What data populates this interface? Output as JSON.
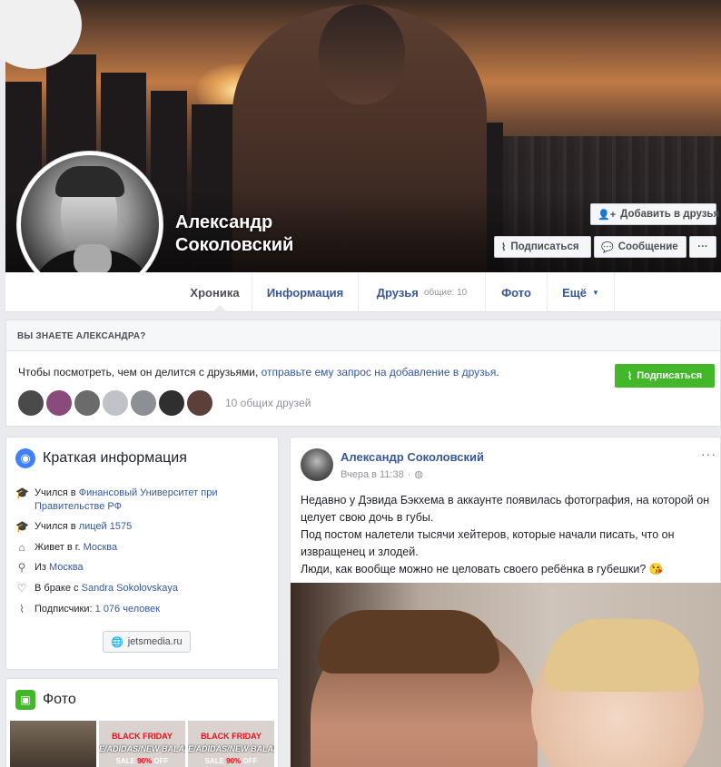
{
  "profile": {
    "name_line1": "Александр",
    "name_line2": "Соколовский"
  },
  "actions": {
    "add_friend": "Добавить в друзья",
    "follow": "Подписаться",
    "message": "Сообщение",
    "more": "···"
  },
  "tabs": [
    {
      "label": "Хроника"
    },
    {
      "label": "Информация"
    },
    {
      "label": "Друзья",
      "sub": "общие: 10"
    },
    {
      "label": "Фото"
    },
    {
      "label": "Ещё",
      "caret": "▼"
    }
  ],
  "know": {
    "heading": "ВЫ ЗНАЕТЕ АЛЕКСАНДРА?",
    "text_before": "Чтобы посмотреть, чем он делится с друзьями,",
    "link": "отправьте ему запрос на добавление в друзья",
    "text_after": ".",
    "follow_button": "Подписаться",
    "mutual_friends": "10 общих друзей"
  },
  "intro": {
    "title": "Краткая информация",
    "rows": [
      {
        "icon": "graduation-cap-icon",
        "prefix": "Учился в",
        "link": "Финансовый Университет при Правительстве РФ"
      },
      {
        "icon": "graduation-cap-icon",
        "prefix": "Учился в",
        "link": "лицей 1575"
      },
      {
        "icon": "home-icon",
        "prefix": "Живет в г.",
        "link": "Москва"
      },
      {
        "icon": "location-pin-icon",
        "prefix": "Из",
        "link": "Москва"
      },
      {
        "icon": "heart-icon",
        "prefix": "В браке с",
        "link": "Sandra Sokolovskaya"
      },
      {
        "icon": "rss-icon",
        "prefix": "Подписчики:",
        "link": "1 076 человек"
      }
    ],
    "website": "jetsmedia.ru"
  },
  "photos": {
    "title": "Фото",
    "promo": {
      "line1": "BLACK FRIDAY",
      "line2": "E/ADIDAS/NEW BALAN",
      "sale": "SALE",
      "percent": "90%",
      "off": "OFF"
    }
  },
  "post": {
    "author": "Александр Соколовский",
    "time": "Вчера в 11:38",
    "more": "···",
    "paragraph1": "Недавно у Дэвида Бэкхема в аккаунте появилась фотография, на которой он целует свою дочь в губы.",
    "paragraph2": "Под постом налетели тысячи хейтеров, которые начали писать, что он извращенец и злодей.",
    "paragraph3": "Люди, как вообще можно не целовать своего ребёнка в губешки? 😘"
  },
  "colors": {
    "link": "#365899",
    "green": "#42b72a",
    "page_bg": "#e9ebee"
  }
}
